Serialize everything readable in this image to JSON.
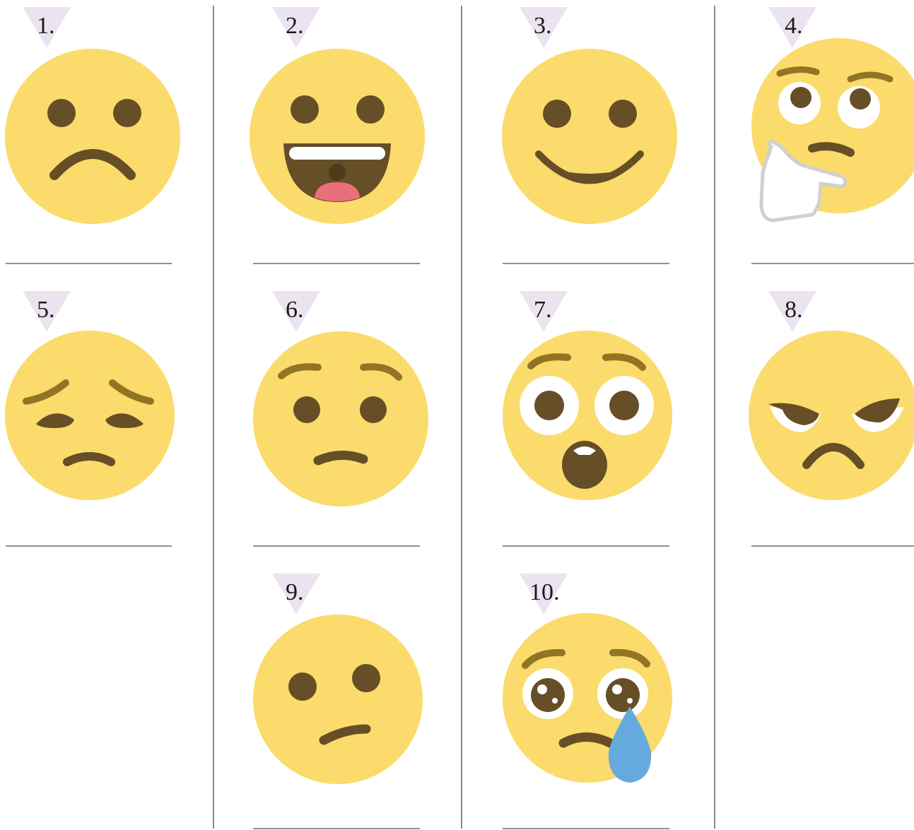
{
  "colors": {
    "face": "#fbdb6b",
    "features": "#664e27",
    "brow": "#917524",
    "badge": "#ece3f0",
    "tear": "#65aadd",
    "tongue": "#e8707c",
    "rule": "#8f8f8f"
  },
  "items": [
    {
      "number": "1.",
      "emotion": "frowning-face"
    },
    {
      "number": "2.",
      "emotion": "grinning-face"
    },
    {
      "number": "3.",
      "emotion": "smiling-face"
    },
    {
      "number": "4.",
      "emotion": "thinking-face"
    },
    {
      "number": "5.",
      "emotion": "disappointed-face"
    },
    {
      "number": "6.",
      "emotion": "worried-face"
    },
    {
      "number": "7.",
      "emotion": "astonished-face"
    },
    {
      "number": "8.",
      "emotion": "angry-face"
    },
    {
      "number": "9.",
      "emotion": "confused-face"
    },
    {
      "number": "10.",
      "emotion": "crying-face"
    }
  ]
}
